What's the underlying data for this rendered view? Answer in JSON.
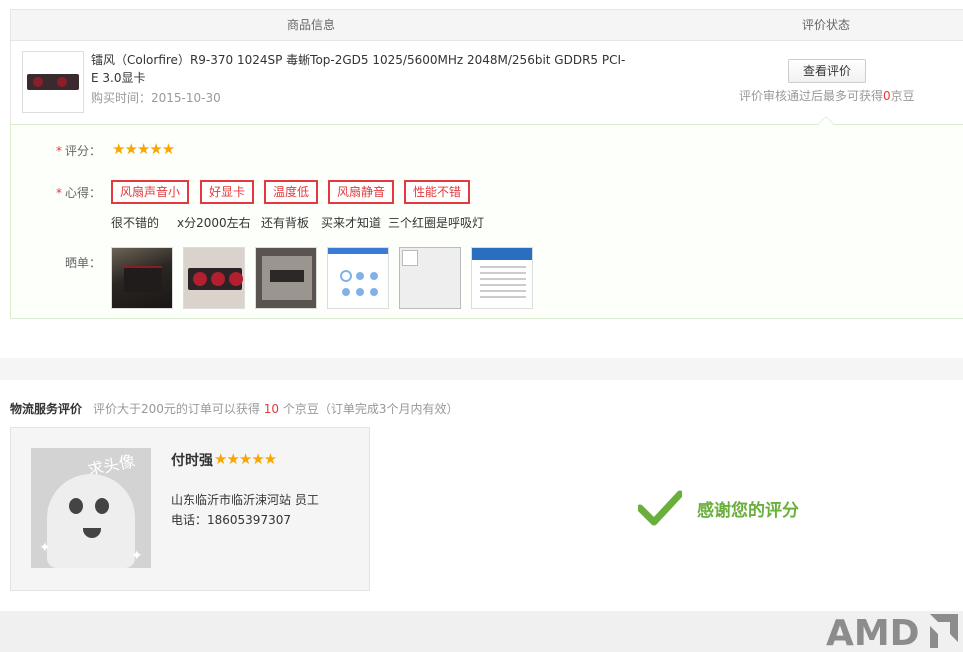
{
  "table_header": {
    "product_info": "商品信息",
    "eval_status": "评价状态"
  },
  "product": {
    "name": "镭风（Colorfire）R9-370 1024SP 毒蜥Top-2GD5 1025/5600MHz 2048M/256bit GDDR5 PCI-E 3.0显卡",
    "purchase_time_label": "购买时间：",
    "purchase_time": "2015-10-30",
    "view_button": "查看评价",
    "reward_note_prefix": "评价审核通过后最多可获得",
    "reward_count": "0",
    "reward_note_suffix": "京豆"
  },
  "evaluation": {
    "score_label": "评分：",
    "score_stars": "★★★★★",
    "rating": 5,
    "experience_label": "心得：",
    "tags": [
      "风扇声音小",
      "好显卡",
      "温度低",
      "风扇静音",
      "性能不错"
    ],
    "review_text": [
      "很不错的",
      "x分2000左右",
      "还有背板",
      "买来才知道",
      "三个红圈是呼吸灯"
    ],
    "photos_label": "晒单："
  },
  "logistics": {
    "title": "物流服务评价",
    "note_prefix": "评价大于200元的订单可以获得",
    "note_count": "10",
    "note_suffix": "个京豆（订单完成3个月内有效）",
    "courier": {
      "avatar_text": "求头像",
      "name": "付时强",
      "stars": "★★★★★",
      "rating": 5,
      "address": "山东临沂市临沂涑河站 员工",
      "phone": "电话：18605397307"
    },
    "thanks": "感谢您的评分"
  },
  "watermark": "AMD",
  "colors": {
    "accent_red": "#e4393c",
    "star": "#f7a700",
    "success_green": "#6aaf3c"
  }
}
